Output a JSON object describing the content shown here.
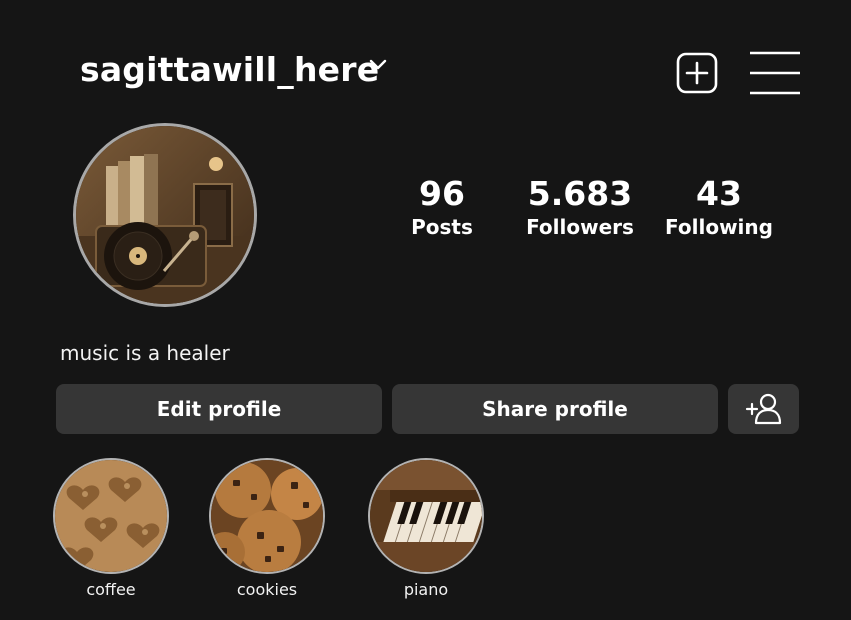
{
  "header": {
    "username": "sagittawill_here",
    "chevron_icon": "chevron-down-icon",
    "new_post_icon": "plus-square-icon",
    "menu_icon": "hamburger-menu-icon"
  },
  "profile": {
    "avatar_description_icon": "record-player-photo",
    "bio": "music is a healer"
  },
  "stats": [
    {
      "value": "96",
      "label": "Posts"
    },
    {
      "value": "5.683",
      "label": "Followers"
    },
    {
      "value": "43",
      "label": "Following"
    }
  ],
  "buttons": {
    "edit_profile": "Edit profile",
    "share_profile": "Share profile",
    "add_user_icon": "add-person-icon"
  },
  "highlights": [
    {
      "label": "coffee"
    },
    {
      "label": "cookies"
    },
    {
      "label": "piano"
    }
  ],
  "colors": {
    "background": "#151515",
    "button_bg": "#363636",
    "text": "#ffffff"
  }
}
